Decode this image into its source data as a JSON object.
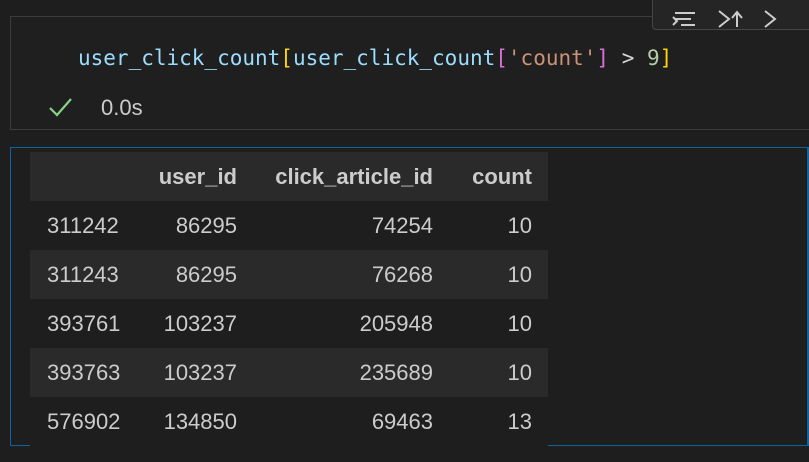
{
  "code": {
    "var1": "user_click_count",
    "bracket_open": "[",
    "var2": "user_click_count",
    "inner_open": "[",
    "key": "'count'",
    "inner_close": "]",
    "op": " > ",
    "num": "9",
    "bracket_close": "]"
  },
  "status": {
    "icon": "check-icon",
    "exec_time": "0.0s"
  },
  "toolbar": {
    "icons": [
      "run-by-line-icon",
      "execute-above-icon",
      "execute-below-icon"
    ]
  },
  "table": {
    "columns": [
      "",
      "user_id",
      "click_article_id",
      "count"
    ],
    "rows": [
      {
        "index": "311242",
        "user_id": "86295",
        "click_article_id": "74254",
        "count": "10"
      },
      {
        "index": "311243",
        "user_id": "86295",
        "click_article_id": "76268",
        "count": "10"
      },
      {
        "index": "393761",
        "user_id": "103237",
        "click_article_id": "205948",
        "count": "10"
      },
      {
        "index": "393763",
        "user_id": "103237",
        "click_article_id": "235689",
        "count": "10"
      },
      {
        "index": "576902",
        "user_id": "134850",
        "click_article_id": "69463",
        "count": "13"
      }
    ]
  },
  "colors": {
    "background": "#1e1e1e",
    "focus_border": "#0e639c",
    "check": "#89d185"
  }
}
